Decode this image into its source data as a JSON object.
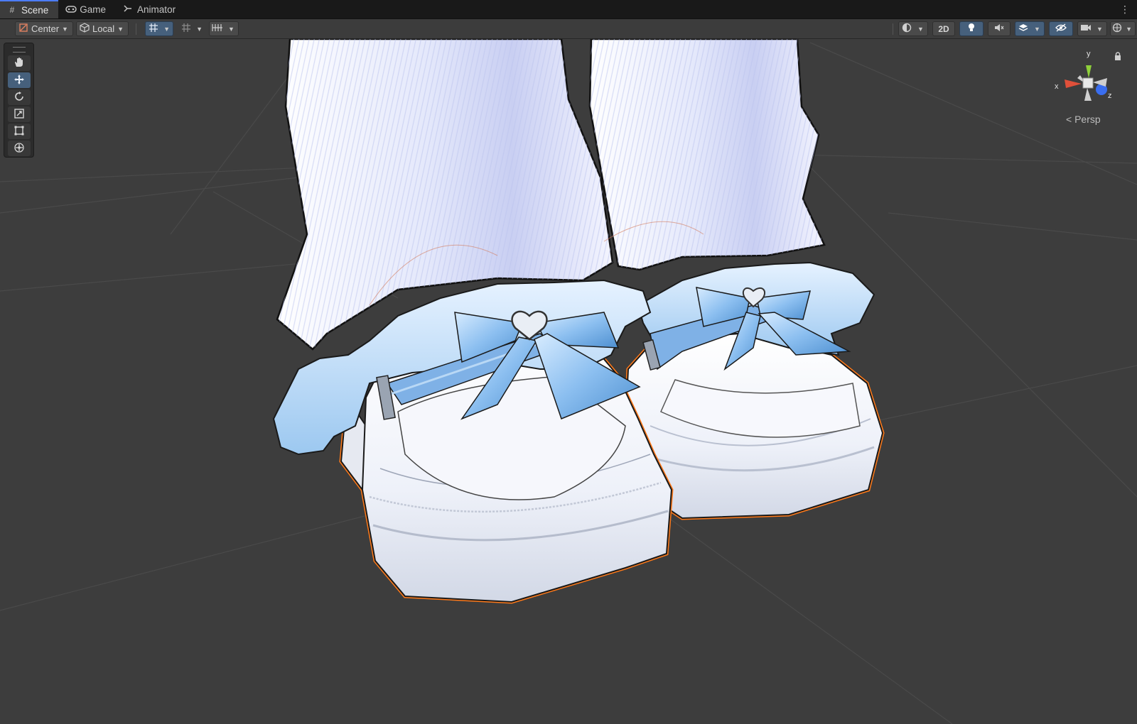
{
  "tabs": [
    {
      "label": "Scene",
      "icon": "grid-icon",
      "active": true
    },
    {
      "label": "Game",
      "icon": "gamepad-icon",
      "active": false
    },
    {
      "label": "Animator",
      "icon": "animator-icon",
      "active": false
    }
  ],
  "toolbar": {
    "pivot_label": "Center",
    "space_label": "Local",
    "mode_2d_label": "2D"
  },
  "tools": [
    "hand-tool",
    "move-tool",
    "rotate-tool",
    "scale-tool",
    "rect-tool",
    "transform-tool"
  ],
  "active_tool": "move-tool",
  "gizmo": {
    "axis_x": "x",
    "axis_y": "y",
    "axis_z": "z",
    "projection_label": "Persp"
  },
  "colors": {
    "selection_outline": "#ff7a1a",
    "active_tab_accent": "#4c7dff",
    "active_button": "#46607c",
    "axis_x": "#e0503a",
    "axis_y": "#8fd13a",
    "axis_z": "#3a6ef0"
  },
  "scene": {
    "object": "white loafers with blue bows and ruffled socks",
    "selection": "shoes outlined in orange"
  }
}
